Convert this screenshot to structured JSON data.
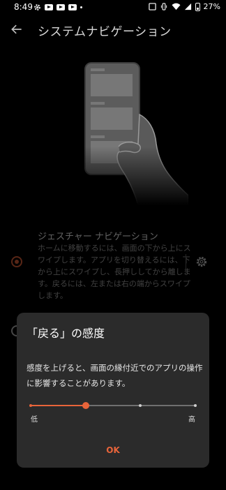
{
  "status_bar": {
    "time": "8:49",
    "battery": "27%"
  },
  "header": {
    "title": "システムナビゲーション"
  },
  "options": [
    {
      "title": "ジェスチャー ナビゲーション",
      "description": "ホームに移動するには、画面の下から上にスワイプします。アプリを切り替えるには、下から上にスワイプし、長押ししてから離します。戻るには、左または右の端からスワイプします。",
      "selected": true
    }
  ],
  "dialog": {
    "title": "「戻る」の感度",
    "message": "感度を上げると、画面の縁付近でのアプリの操作に影響することがあります。",
    "slider": {
      "value_fraction": 0.333,
      "steps": 4,
      "low_label": "低",
      "high_label": "高"
    },
    "ok_label": "OK"
  },
  "colors": {
    "accent": "#e8643a",
    "background": "#000000",
    "dialog": "#2b2b2b"
  }
}
